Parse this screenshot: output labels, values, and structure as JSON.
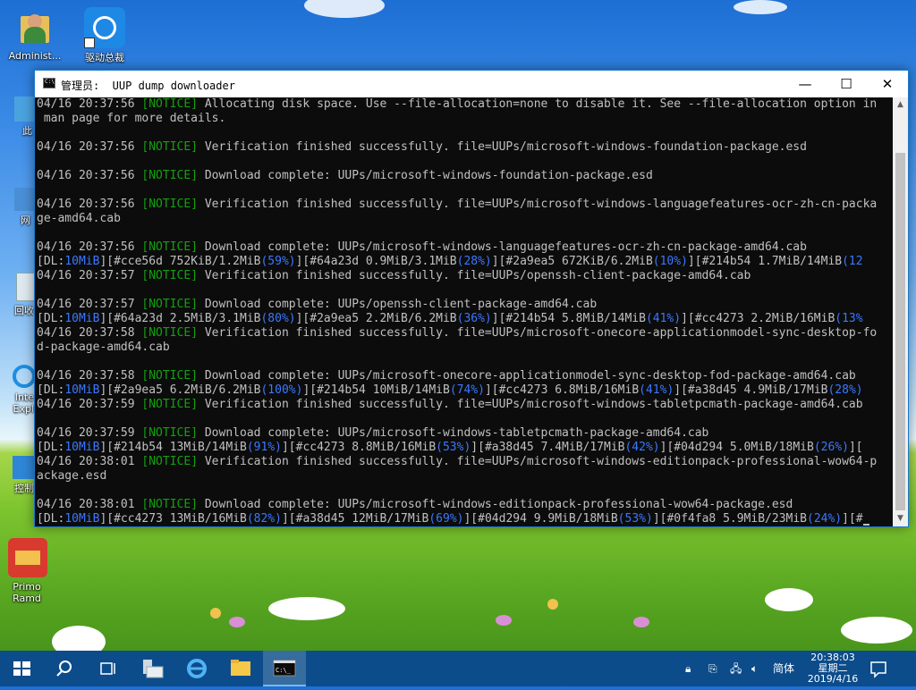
{
  "desktop": {
    "icons": [
      {
        "label": "Administ..."
      },
      {
        "label": "驱动总裁"
      },
      {
        "label": "此"
      },
      {
        "label": "网"
      },
      {
        "label": "回收"
      },
      {
        "label": "Inte Expl"
      },
      {
        "label": "控制"
      },
      {
        "label": "Primo Ramd"
      }
    ]
  },
  "window": {
    "title": "管理员:  UUP dump downloader",
    "minimize": "—",
    "maximize": "☐",
    "close": "✕"
  },
  "console": {
    "lines": [
      {
        "t": "04/16 20:37:56 ",
        "tag": "[NOTICE]",
        "msg": " Allocating disk space. Use --file-allocation=none to disable it. See --file-allocation option in"
      },
      {
        "plain": " man page for more details."
      },
      {
        "blank": true
      },
      {
        "t": "04/16 20:37:56 ",
        "tag": "[NOTICE]",
        "msg": " Verification finished successfully. file=UUPs/microsoft-windows-foundation-package.esd"
      },
      {
        "blank": true
      },
      {
        "t": "04/16 20:37:56 ",
        "tag": "[NOTICE]",
        "msg": " Download complete: UUPs/microsoft-windows-foundation-package.esd"
      },
      {
        "blank": true
      },
      {
        "t": "04/16 20:37:56 ",
        "tag": "[NOTICE]",
        "msg": " Verification finished successfully. file=UUPs/microsoft-windows-languagefeatures-ocr-zh-cn-packa"
      },
      {
        "plain": "ge-amd64.cab"
      },
      {
        "blank": true
      },
      {
        "t": "04/16 20:37:56 ",
        "tag": "[NOTICE]",
        "msg": " Download complete: UUPs/microsoft-windows-languagefeatures-ocr-zh-cn-package-amd64.cab"
      },
      {
        "dl": [
          [
            "[DL:",
            "10MiB",
            "][#cce56d 752KiB/1.2MiB",
            "(59%)",
            "][#64a23d 0.9MiB/3.1MiB",
            "(28%)",
            "][#2a9ea5 672KiB/6.2MiB",
            "(10%)",
            "][#214b54 1.7MiB/14MiB",
            "(12"
          ]
        ]
      },
      {
        "t": "04/16 20:37:57 ",
        "tag": "[NOTICE]",
        "msg": " Verification finished successfully. file=UUPs/openssh-client-package-amd64.cab"
      },
      {
        "blank": true
      },
      {
        "t": "04/16 20:37:57 ",
        "tag": "[NOTICE]",
        "msg": " Download complete: UUPs/openssh-client-package-amd64.cab"
      },
      {
        "dl": [
          [
            "[DL:",
            "10MiB",
            "][#64a23d 2.5MiB/3.1MiB",
            "(80%)",
            "][#2a9ea5 2.2MiB/6.2MiB",
            "(36%)",
            "][#214b54 5.8MiB/14MiB",
            "(41%)",
            "][#cc4273 2.2MiB/16MiB",
            "(13%"
          ]
        ]
      },
      {
        "t": "04/16 20:37:58 ",
        "tag": "[NOTICE]",
        "msg": " Verification finished successfully. file=UUPs/microsoft-onecore-applicationmodel-sync-desktop-fo"
      },
      {
        "plain": "d-package-amd64.cab"
      },
      {
        "blank": true
      },
      {
        "t": "04/16 20:37:58 ",
        "tag": "[NOTICE]",
        "msg": " Download complete: UUPs/microsoft-onecore-applicationmodel-sync-desktop-fod-package-amd64.cab"
      },
      {
        "dl": [
          [
            "[DL:",
            "10MiB",
            "][#2a9ea5 6.2MiB/6.2MiB",
            "(100%)",
            "][#214b54 10MiB/14MiB",
            "(74%)",
            "][#cc4273 6.8MiB/16MiB",
            "(41%)",
            "][#a38d45 4.9MiB/17MiB",
            "(28%)"
          ]
        ]
      },
      {
        "t": "04/16 20:37:59 ",
        "tag": "[NOTICE]",
        "msg": " Verification finished successfully. file=UUPs/microsoft-windows-tabletpcmath-package-amd64.cab"
      },
      {
        "blank": true
      },
      {
        "t": "04/16 20:37:59 ",
        "tag": "[NOTICE]",
        "msg": " Download complete: UUPs/microsoft-windows-tabletpcmath-package-amd64.cab"
      },
      {
        "dl": [
          [
            "[DL:",
            "10MiB",
            "][#214b54 13MiB/14MiB",
            "(91%)",
            "][#cc4273 8.8MiB/16MiB",
            "(53%)",
            "][#a38d45 7.4MiB/17MiB",
            "(42%)",
            "][#04d294 5.0MiB/18MiB",
            "(26%)",
            "]["
          ]
        ]
      },
      {
        "t": "04/16 20:38:01 ",
        "tag": "[NOTICE]",
        "msg": " Verification finished successfully. file=UUPs/microsoft-windows-editionpack-professional-wow64-p"
      },
      {
        "plain": "ackage.esd"
      },
      {
        "blank": true
      },
      {
        "t": "04/16 20:38:01 ",
        "tag": "[NOTICE]",
        "msg": " Download complete: UUPs/microsoft-windows-editionpack-professional-wow64-package.esd"
      },
      {
        "dl": [
          [
            "[DL:",
            "10MiB",
            "][#cc4273 13MiB/16MiB",
            "(82%)",
            "][#a38d45 12MiB/17MiB",
            "(69%)",
            "][#04d294 9.9MiB/18MiB",
            "(53%)",
            "][#0f4fa8 5.9MiB/23MiB",
            "(24%)",
            "][#"
          ]
        ],
        "cursor": true
      }
    ]
  },
  "taskbar": {
    "tray": {
      "ime": "简体",
      "time": "20:38:03",
      "weekday": "星期二",
      "date": "2019/4/16"
    }
  },
  "colors": {
    "notice": "#13a10e",
    "dl": "#3b78ff",
    "console_bg": "#0c0c0c",
    "taskbar": "#0c4c8a"
  }
}
